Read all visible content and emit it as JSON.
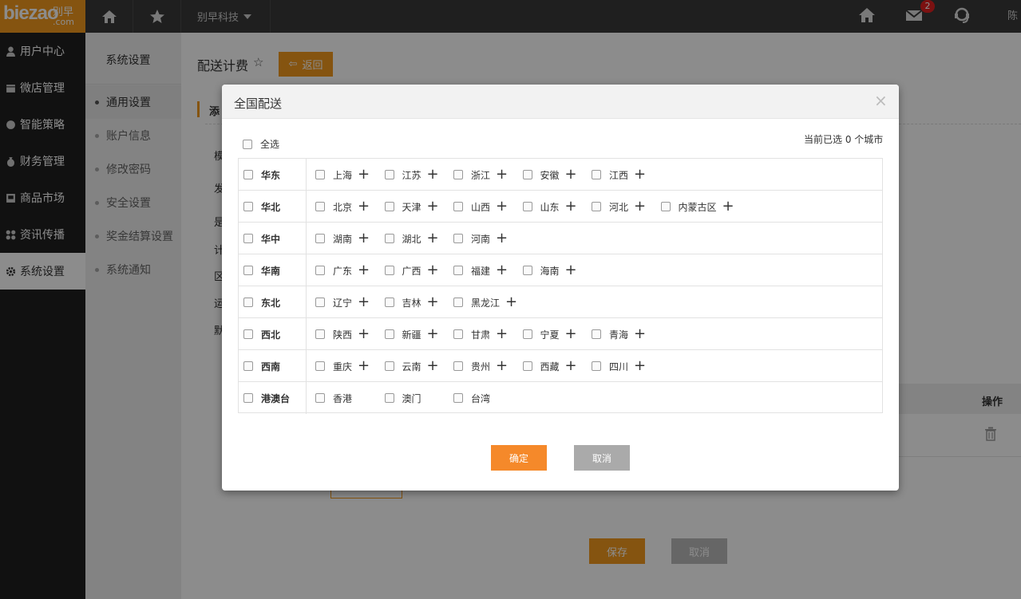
{
  "logo": {
    "main": "biezao",
    "cn": "别早",
    "dotcom": ".com"
  },
  "topbar": {
    "company": "别早科技",
    "mail_count": "2",
    "user_name": "陈"
  },
  "sidebar": {
    "items": [
      {
        "label": "用户中心",
        "icon": "user-icon"
      },
      {
        "label": "微店管理",
        "icon": "store-icon"
      },
      {
        "label": "智能策略",
        "icon": "strategy-icon"
      },
      {
        "label": "财务管理",
        "icon": "money-icon"
      },
      {
        "label": "商品市场",
        "icon": "market-icon"
      },
      {
        "label": "资讯传播",
        "icon": "news-icon"
      },
      {
        "label": "系统设置",
        "icon": "gear-icon",
        "active": true
      }
    ]
  },
  "subside": {
    "title": "系统设置",
    "items": [
      {
        "label": "通用设置",
        "active": true
      },
      {
        "label": "账户信息"
      },
      {
        "label": "修改密码"
      },
      {
        "label": "安全设置"
      },
      {
        "label": "奖金结算设置"
      },
      {
        "label": "系统通知"
      }
    ]
  },
  "main": {
    "title": "配送计费",
    "back_label": "返回",
    "section": "添",
    "form_labels": [
      "模",
      "发",
      "是",
      "计",
      "区",
      "运",
      "默"
    ],
    "op_header": "操作",
    "save_label": "保存",
    "cancel_label": "取消"
  },
  "modal": {
    "title": "全国配送",
    "select_all": "全选",
    "count_text": "当前已选 0 个城市",
    "ok_label": "确定",
    "cancel_label": "取消",
    "regions": [
      {
        "name": "华东",
        "provinces": [
          "上海",
          "江苏",
          "浙江",
          "安徽",
          "江西"
        ],
        "expandable": true
      },
      {
        "name": "华北",
        "provinces": [
          "北京",
          "天津",
          "山西",
          "山东",
          "河北",
          "内蒙古区"
        ],
        "expandable": true
      },
      {
        "name": "华中",
        "provinces": [
          "湖南",
          "湖北",
          "河南"
        ],
        "expandable": true
      },
      {
        "name": "华南",
        "provinces": [
          "广东",
          "广西",
          "福建",
          "海南"
        ],
        "expandable": true
      },
      {
        "name": "东北",
        "provinces": [
          "辽宁",
          "吉林",
          "黑龙江"
        ],
        "expandable": true
      },
      {
        "name": "西北",
        "provinces": [
          "陕西",
          "新疆",
          "甘肃",
          "宁夏",
          "青海"
        ],
        "expandable": true
      },
      {
        "name": "西南",
        "provinces": [
          "重庆",
          "云南",
          "贵州",
          "西藏",
          "四川"
        ],
        "expandable": true
      },
      {
        "name": "港澳台",
        "provinces": [
          "香港",
          "澳门",
          "台湾"
        ],
        "expandable": false
      }
    ]
  },
  "colors": {
    "accent": "#f39a1e",
    "topbar": "#3a3a3a",
    "sidebar": "#1f1f1f"
  }
}
